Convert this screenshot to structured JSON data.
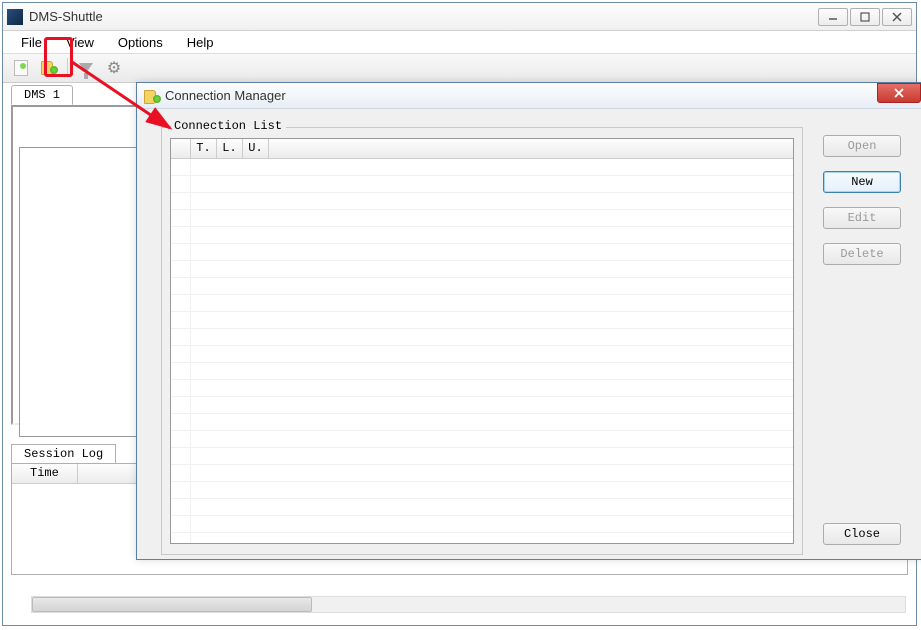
{
  "app": {
    "title": "DMS-Shuttle"
  },
  "menu": {
    "file": "File",
    "view": "View",
    "options": "Options",
    "help": "Help"
  },
  "tabs": {
    "main": "DMS 1"
  },
  "sessionLog": {
    "tab": "Session Log",
    "timeCol": "Time"
  },
  "dialog": {
    "title": "Connection Manager",
    "groupLabel": "Connection List",
    "columns": {
      "t": "T.",
      "l": "L.",
      "u": "U."
    },
    "buttons": {
      "open": "Open",
      "new": "New",
      "edit": "Edit",
      "delete": "Delete",
      "close": "Close"
    }
  }
}
